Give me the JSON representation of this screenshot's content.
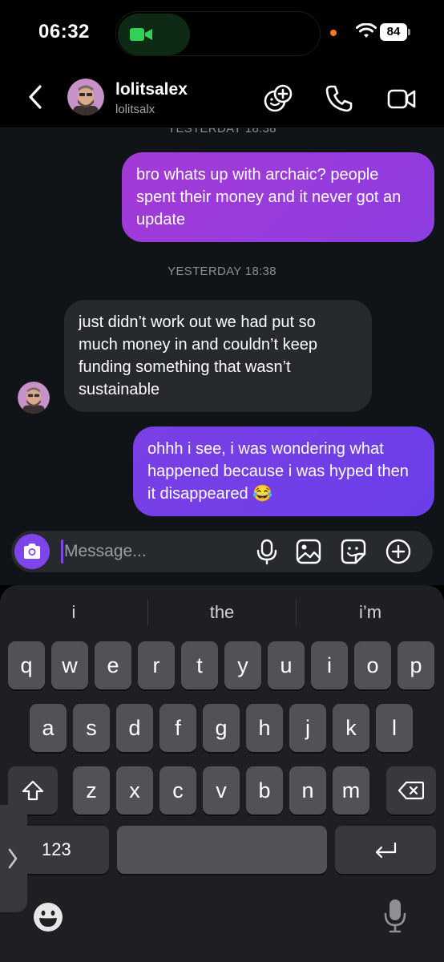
{
  "status_bar": {
    "time": "06:32",
    "battery": "84",
    "icons": [
      "facetime-video-icon",
      "wifi-icon",
      "battery-icon"
    ],
    "colors": {
      "call_pill": "#0f2a14",
      "call_icon": "#31d158",
      "mic_dot": "#ff7a1a"
    }
  },
  "header": {
    "contact_name": "lolitsalex",
    "contact_handle": "lolitsalx",
    "icons": [
      "back-chevron-icon",
      "avatar",
      "chat-effects-icon",
      "phone-icon",
      "video-call-icon"
    ]
  },
  "chat": {
    "timestamp_cut": "YESTERDAY 18:38",
    "messages": [
      {
        "direction": "outgoing",
        "text": "bro whats up with archaic? people spent their money and it never got an update"
      },
      {
        "timestamp": "YESTERDAY 18:38"
      },
      {
        "direction": "incoming",
        "text": "just didn’t work out we had put so much money in and couldn’t keep funding something that wasn’t sustainable"
      },
      {
        "direction": "outgoing",
        "text": "ohhh i see, i was wondering what happened because i was hyped then it disappeared 😂"
      }
    ],
    "colors": {
      "outgoing_1": "#a43ad6",
      "outgoing_2": "#7b3fe6",
      "incoming": "#26292d",
      "background": "#101317"
    }
  },
  "composer": {
    "placeholder": "Message...",
    "icons": [
      "camera-icon",
      "microphone-icon",
      "gallery-icon",
      "sticker-icon",
      "add-icon"
    ],
    "accent": "#7d45ea"
  },
  "keyboard": {
    "suggestions": [
      "i",
      "the",
      "i’m"
    ],
    "row1": [
      "q",
      "w",
      "e",
      "r",
      "t",
      "y",
      "u",
      "i",
      "o",
      "p"
    ],
    "row2": [
      "a",
      "s",
      "d",
      "f",
      "g",
      "h",
      "j",
      "k",
      "l"
    ],
    "row3": [
      "z",
      "x",
      "c",
      "v",
      "b",
      "n",
      "m"
    ],
    "numbers_label": "123",
    "icons": [
      "shift-icon",
      "backspace-icon",
      "return-icon",
      "emoji-icon",
      "dictation-icon",
      "keyboard-collapse-icon"
    ]
  }
}
